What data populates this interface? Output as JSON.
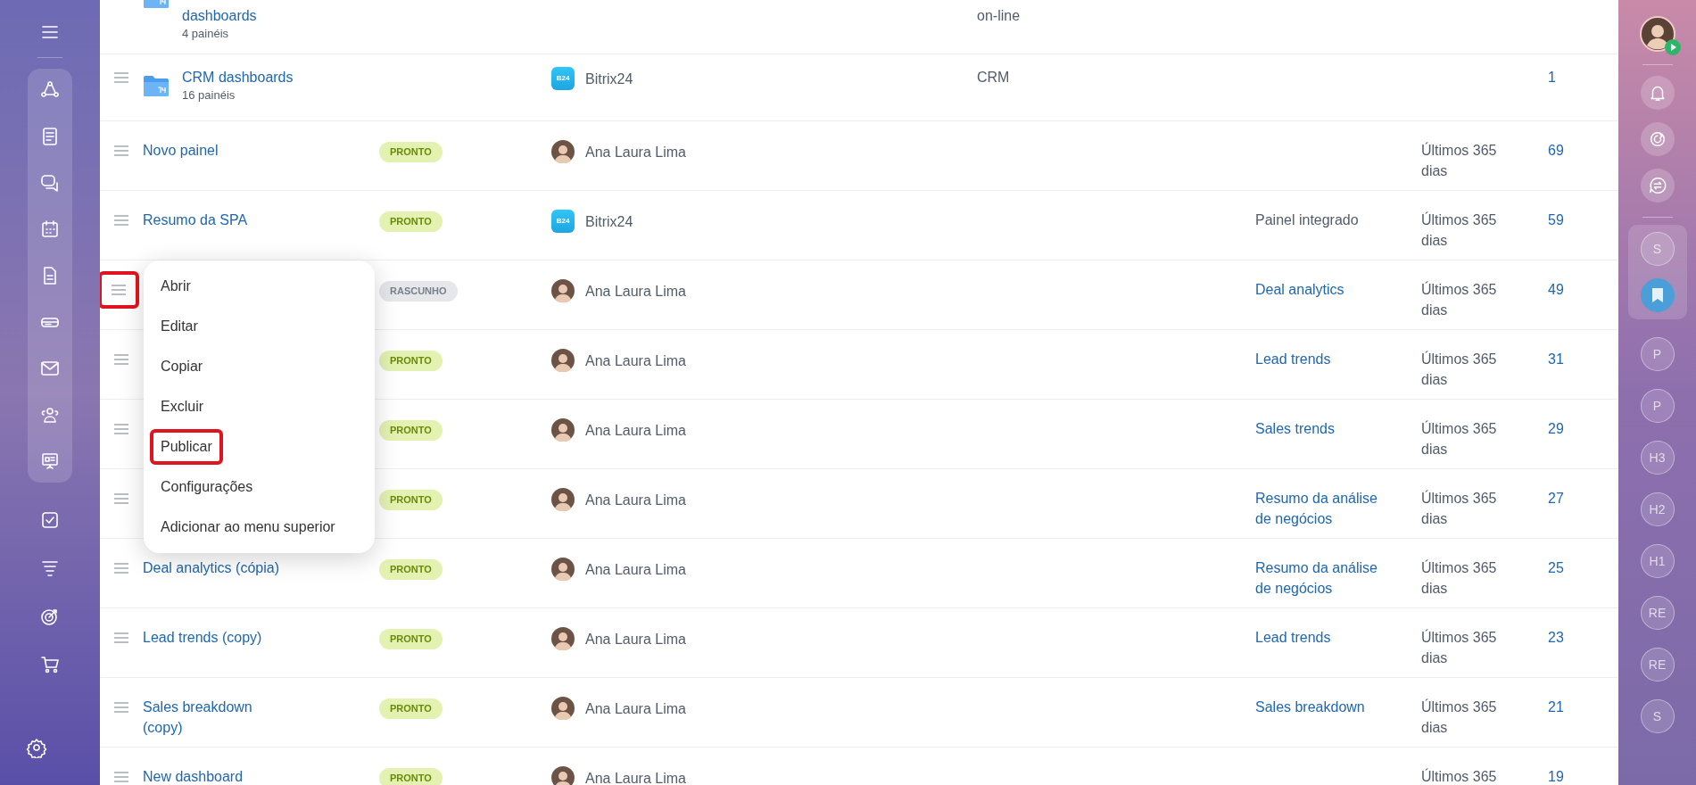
{
  "rows": [
    {
      "kind": "folder",
      "cut_top": true,
      "name": "dashboards",
      "subtitle": "4 painéis",
      "type": "on-line"
    },
    {
      "kind": "folder",
      "name": "CRM dashboards",
      "subtitle": "16 painéis",
      "owner": {
        "kind": "system",
        "name": "Bitrix24",
        "logo": "B24"
      },
      "type": "CRM",
      "count": "1",
      "drag_highlighted": false
    },
    {
      "kind": "dashboard",
      "name": "Novo painel",
      "status": {
        "kind": "ready",
        "label": "PRONTO"
      },
      "owner": {
        "kind": "user",
        "name": "Ana Laura Lima"
      },
      "period": "Últimos 365 dias",
      "count": "69",
      "drag_highlighted": false
    },
    {
      "kind": "dashboard",
      "name": "Resumo da SPA",
      "status": {
        "kind": "ready",
        "label": "PRONTO"
      },
      "owner": {
        "kind": "system",
        "name": "Bitrix24",
        "logo": "B24"
      },
      "related": {
        "text": "Painel integrado",
        "link": false
      },
      "period": "Últimos 365 dias",
      "count": "59",
      "drag_highlighted": false
    },
    {
      "kind": "dashboard",
      "status": {
        "kind": "draft",
        "label": "RASCUNHO"
      },
      "owner": {
        "kind": "user",
        "name": "Ana Laura Lima"
      },
      "related": {
        "text": "Deal analytics",
        "link": true
      },
      "period": "Últimos 365 dias",
      "count": "49",
      "drag_highlighted": true
    },
    {
      "kind": "dashboard",
      "status": {
        "kind": "ready",
        "label": "PRONTO"
      },
      "owner": {
        "kind": "user",
        "name": "Ana Laura Lima"
      },
      "related": {
        "text": "Lead trends",
        "link": true
      },
      "period": "Últimos 365 dias",
      "count": "31",
      "drag_highlighted": false
    },
    {
      "kind": "dashboard",
      "status": {
        "kind": "ready",
        "label": "PRONTO"
      },
      "owner": {
        "kind": "user",
        "name": "Ana Laura Lima"
      },
      "related": {
        "text": "Sales trends",
        "link": true
      },
      "period": "Últimos 365 dias",
      "count": "29",
      "drag_highlighted": false
    },
    {
      "kind": "dashboard",
      "status": {
        "kind": "ready",
        "label": "PRONTO"
      },
      "owner": {
        "kind": "user",
        "name": "Ana Laura Lima"
      },
      "related": {
        "text": "Resumo da análise de negócios",
        "link": true
      },
      "period": "Últimos 365 dias",
      "count": "27",
      "drag_highlighted": false
    },
    {
      "kind": "dashboard",
      "name": "Deal analytics (cópia)",
      "status": {
        "kind": "ready",
        "label": "PRONTO"
      },
      "owner": {
        "kind": "user",
        "name": "Ana Laura Lima"
      },
      "related": {
        "text": "Resumo da análise de negócios",
        "link": true
      },
      "period": "Últimos 365 dias",
      "count": "25",
      "drag_highlighted": false
    },
    {
      "kind": "dashboard",
      "name": "Lead trends (copy)",
      "status": {
        "kind": "ready",
        "label": "PRONTO"
      },
      "owner": {
        "kind": "user",
        "name": "Ana Laura Lima"
      },
      "related": {
        "text": "Lead trends",
        "link": true
      },
      "period": "Últimos 365 dias",
      "count": "23",
      "drag_highlighted": false
    },
    {
      "kind": "dashboard",
      "name": "Sales breakdown (copy)",
      "status": {
        "kind": "ready",
        "label": "PRONTO"
      },
      "owner": {
        "kind": "user",
        "name": "Ana Laura Lima"
      },
      "related": {
        "text": "Sales breakdown",
        "link": true
      },
      "period": "Últimos 365 dias",
      "count": "21",
      "drag_highlighted": false
    },
    {
      "kind": "dashboard",
      "name": "New dashboard",
      "status": {
        "kind": "ready",
        "label": "PRONTO"
      },
      "owner": {
        "kind": "user",
        "name": "Ana Laura Lima"
      },
      "period": "Últimos 365",
      "count": "19",
      "drag_highlighted": false
    }
  ],
  "context_menu": {
    "items": [
      {
        "label": "Abrir",
        "highlighted": false
      },
      {
        "label": "Editar",
        "highlighted": false
      },
      {
        "label": "Copiar",
        "highlighted": false
      },
      {
        "label": "Excluir",
        "highlighted": false
      },
      {
        "label": "Publicar",
        "highlighted": true
      },
      {
        "label": "Configurações",
        "highlighted": false
      },
      {
        "label": "Adicionar ao menu superior",
        "highlighted": false
      }
    ]
  },
  "right_sidebar": {
    "pinned": [
      {
        "kind": "letter",
        "label": "S",
        "selected": false
      },
      {
        "kind": "bookmark",
        "selected": true
      }
    ],
    "chats": [
      {
        "kind": "letter",
        "label": "P",
        "selected": false
      },
      {
        "kind": "letter",
        "label": "P",
        "selected": false
      },
      {
        "kind": "letter",
        "label": "H3",
        "selected": false
      },
      {
        "kind": "letter",
        "label": "H2",
        "selected": false
      },
      {
        "kind": "letter",
        "label": "H1",
        "selected": false
      },
      {
        "kind": "letter",
        "label": "RE",
        "selected": false
      },
      {
        "kind": "letter",
        "label": "RE",
        "selected": false
      },
      {
        "kind": "letter",
        "label": "S",
        "selected": false
      }
    ]
  }
}
